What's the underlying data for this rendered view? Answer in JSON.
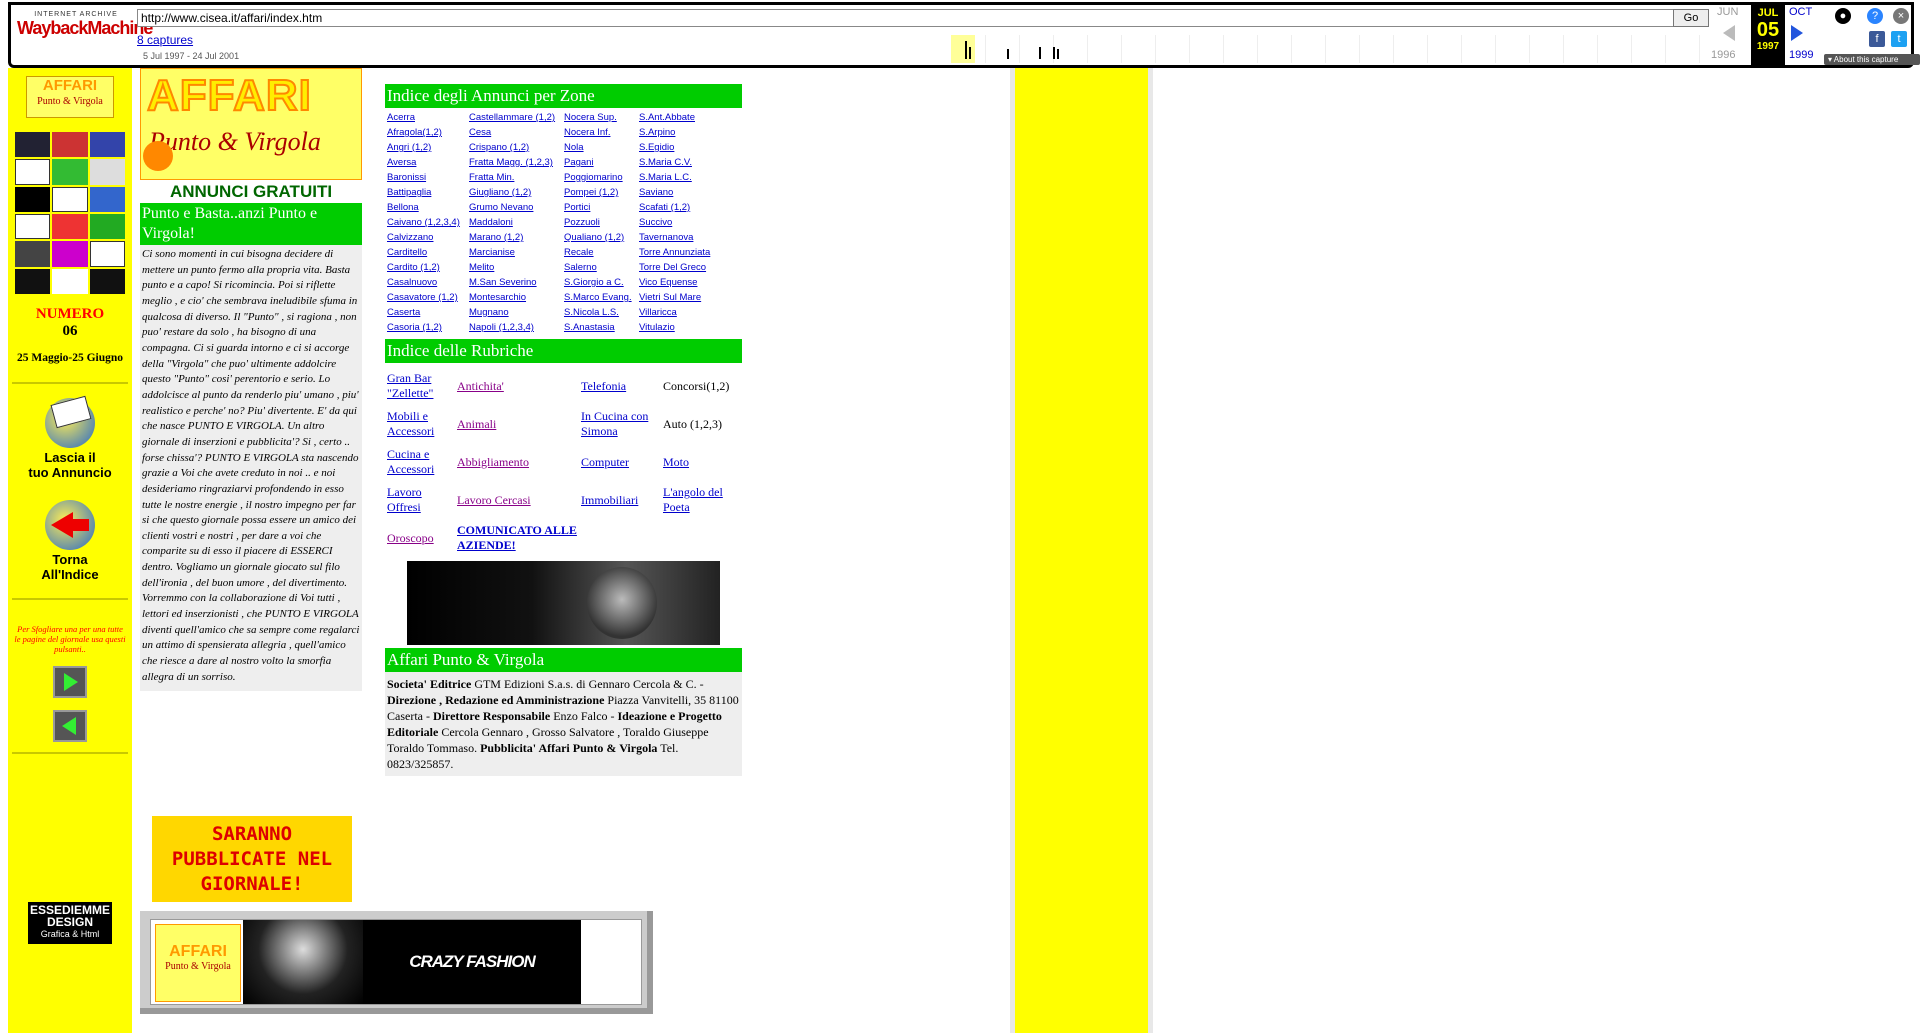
{
  "wayback": {
    "brand_top": "INTERNET ARCHIVE",
    "brand_main": "WaybackMachine",
    "url": "http://www.cisea.it/affari/index.htm",
    "go_label": "Go",
    "captures_label": "8 captures",
    "date_range": "5 Jul 1997 - 24 Jul 2001",
    "prev_month": "JUN",
    "current_month": "JUL",
    "next_month": "OCT",
    "current_day": "05",
    "prev_year": "1996",
    "current_year": "1997",
    "next_year": "1999",
    "about_label": "About this capture"
  },
  "sidebar": {
    "logo_text_1": "AFFARI",
    "logo_text_2": "Punto & Virgola",
    "numero_label": "NUMERO",
    "numero_value": "06",
    "dates": "25 Maggio-25 Giugno",
    "leave_ad_label_1": "Lascia il",
    "leave_ad_label_2": "tuo Annuncio",
    "back_label_1": "Torna",
    "back_label_2": "All'Indice",
    "browse_hint_1": "Per Sfogliare una per una tutte",
    "browse_hint_2": "le pagine del giornale usa questi pulsanti..",
    "essediemme_1": "ESSEDIEMME",
    "essediemme_2": "DESIGN",
    "essediemme_3": "Grafica & Html"
  },
  "intro": {
    "logo_text_1": "AFFARI",
    "logo_text_2": "Punto & Virgola",
    "free_ads": "ANNUNCI GRATUITI",
    "headline": "Punto e Basta..anzi Punto e Virgola!",
    "body": "Ci sono momenti in cui bisogna decidere di mettere un punto fermo alla propria vita. Basta punto e a capo! Si ricomincia. Poi si riflette meglio , e cio' che sembrava ineludibile sfuma in qualcosa di diverso. Il \"Punto\" , si ragiona , non puo' restare da solo , ha bisogno di una compagna. Ci si guarda intorno e ci si accorge della \"Virgola\" che puo' ultimente addolcire questo \"Punto\" cosi' perentorio e serio. Lo addolcisce al punto da renderlo piu' umano , piu' realistico e perche' no? Piu' divertente. E' da qui che nasce PUNTO E VIRGOLA. Un altro giornale di inserzioni e pubblicita'? Si , certo .. forse chissa'? PUNTO E VIRGOLA sta nascendo grazie a Voi che avete creduto in noi .. e noi desideriamo ringraziarvi profondendo in esso tutte le nostre energie , il nostro impegno per far si che questo giornale possa essere un amico dei clienti vostri e nostri , per dare a voi che comparite su di esso il piacere di ESSERCI dentro. Vogliamo un giornale giocato sul filo dell'ironia , del buon umore , del divertimento. Vorremmo con la collaborazione di Voi tutti , lettori ed inserzionisti , che PUNTO E VIRGOLA diventi quell'amico che sa sempre come regalarci un attimo di spensierata allegria , quell'amico che riesce a dare al nostro volto la smorfia allegra di un sorriso.",
    "banner": "SARANNO PUBBLICATE NEL GIORNALE!"
  },
  "zones": {
    "title": "Indice degli Annunci per Zone",
    "items": [
      "Acerra",
      "Castellammare (1,2)",
      "Nocera Sup.",
      "S.Ant.Abbate",
      "Afragola(1,2)",
      "Cesa",
      "Nocera Inf.",
      "S.Arpino",
      "Angri (1,2)",
      "Crispano (1,2)",
      "Nola",
      "S.Egidio",
      "Aversa",
      "Fratta Magg. (1,2,3)",
      "Pagani",
      "S.Maria C.V.",
      "Baronissi",
      "Fratta Min.",
      "Poggiomarino",
      "S.Maria L.C.",
      "Battipaglia",
      "Giugliano (1,2)",
      "Pompei (1,2)",
      "Saviano",
      "Bellona",
      "Grumo Nevano",
      "Portici",
      "Scafati (1,2)",
      "Caivano (1,2,3,4)",
      "Maddaloni",
      "Pozzuoli",
      "Succivo",
      "Calvizzano",
      "Marano (1,2)",
      "Qualiano (1,2)",
      "Tavernanova",
      "Carditello",
      "Marcianise",
      "Recale",
      "Torre Annunziata",
      "Cardito (1,2)",
      "Melito",
      "Salerno",
      "Torre Del Greco",
      "Casalnuovo",
      "M.San Severino",
      "S.Giorgio a C.",
      "Vico Equense",
      "Casavatore (1,2)",
      "Montesarchio",
      "S.Marco Evang.",
      "Vietri Sul Mare",
      "Caserta",
      "Mugnano",
      "S.Nicola L.S.",
      "Villaricca",
      "Casoria (1,2)",
      "Napoli (1,2,3,4)",
      "S.Anastasia",
      "Vitulazio"
    ]
  },
  "rubriche": {
    "title": "Indice delle Rubriche",
    "items": [
      "Gran Bar \"Zellette\"",
      "Antichita'",
      "Telefonia",
      "Concorsi(1,2)",
      "Mobili e Accessori",
      "Animali",
      "In Cucina con Simona",
      "Auto (1,2,3)",
      "Cucina e Accessori",
      "Abbigliamento",
      "Computer",
      "Moto",
      "Lavoro Offresi",
      "Lavoro Cercasi",
      "Immobiliari",
      "L'angolo del Poeta",
      "Oroscopo",
      "COMUNICATO ALLE AZIENDE!",
      "",
      ""
    ]
  },
  "publisher": {
    "title": "Affari Punto & Virgola",
    "text_1_bold": "Societa' Editrice",
    "text_1": " GTM Edizioni S.a.s. di Gennaro Cercola & C. - ",
    "text_2_bold": "Direzione , Redazione ed Amministrazione",
    "text_2": " Piazza Vanvitelli, 35 81100 Caserta - ",
    "text_3_bold": "Direttore Responsabile",
    "text_3": " Enzo Falco - ",
    "text_4_bold": "Ideazione e Progetto Editoriale",
    "text_4": " Cercola Gennaro , Grosso Salvatore , Toraldo Giuseppe Toraldo Tommaso. ",
    "text_5_bold": "Pubblicita' Affari Punto & Virgola",
    "text_5": " Tel. 0823/325857."
  },
  "footer_banner": {
    "logo_text_1": "AFFARI",
    "logo_text_2": "Punto & Virgola",
    "sponsor": "CRAZY FASHION"
  },
  "colors": {
    "page_yellow": "#ffff00",
    "header_green": "#00cc00",
    "numero_red": "#ff0000",
    "logo_orange": "#ff8800"
  }
}
